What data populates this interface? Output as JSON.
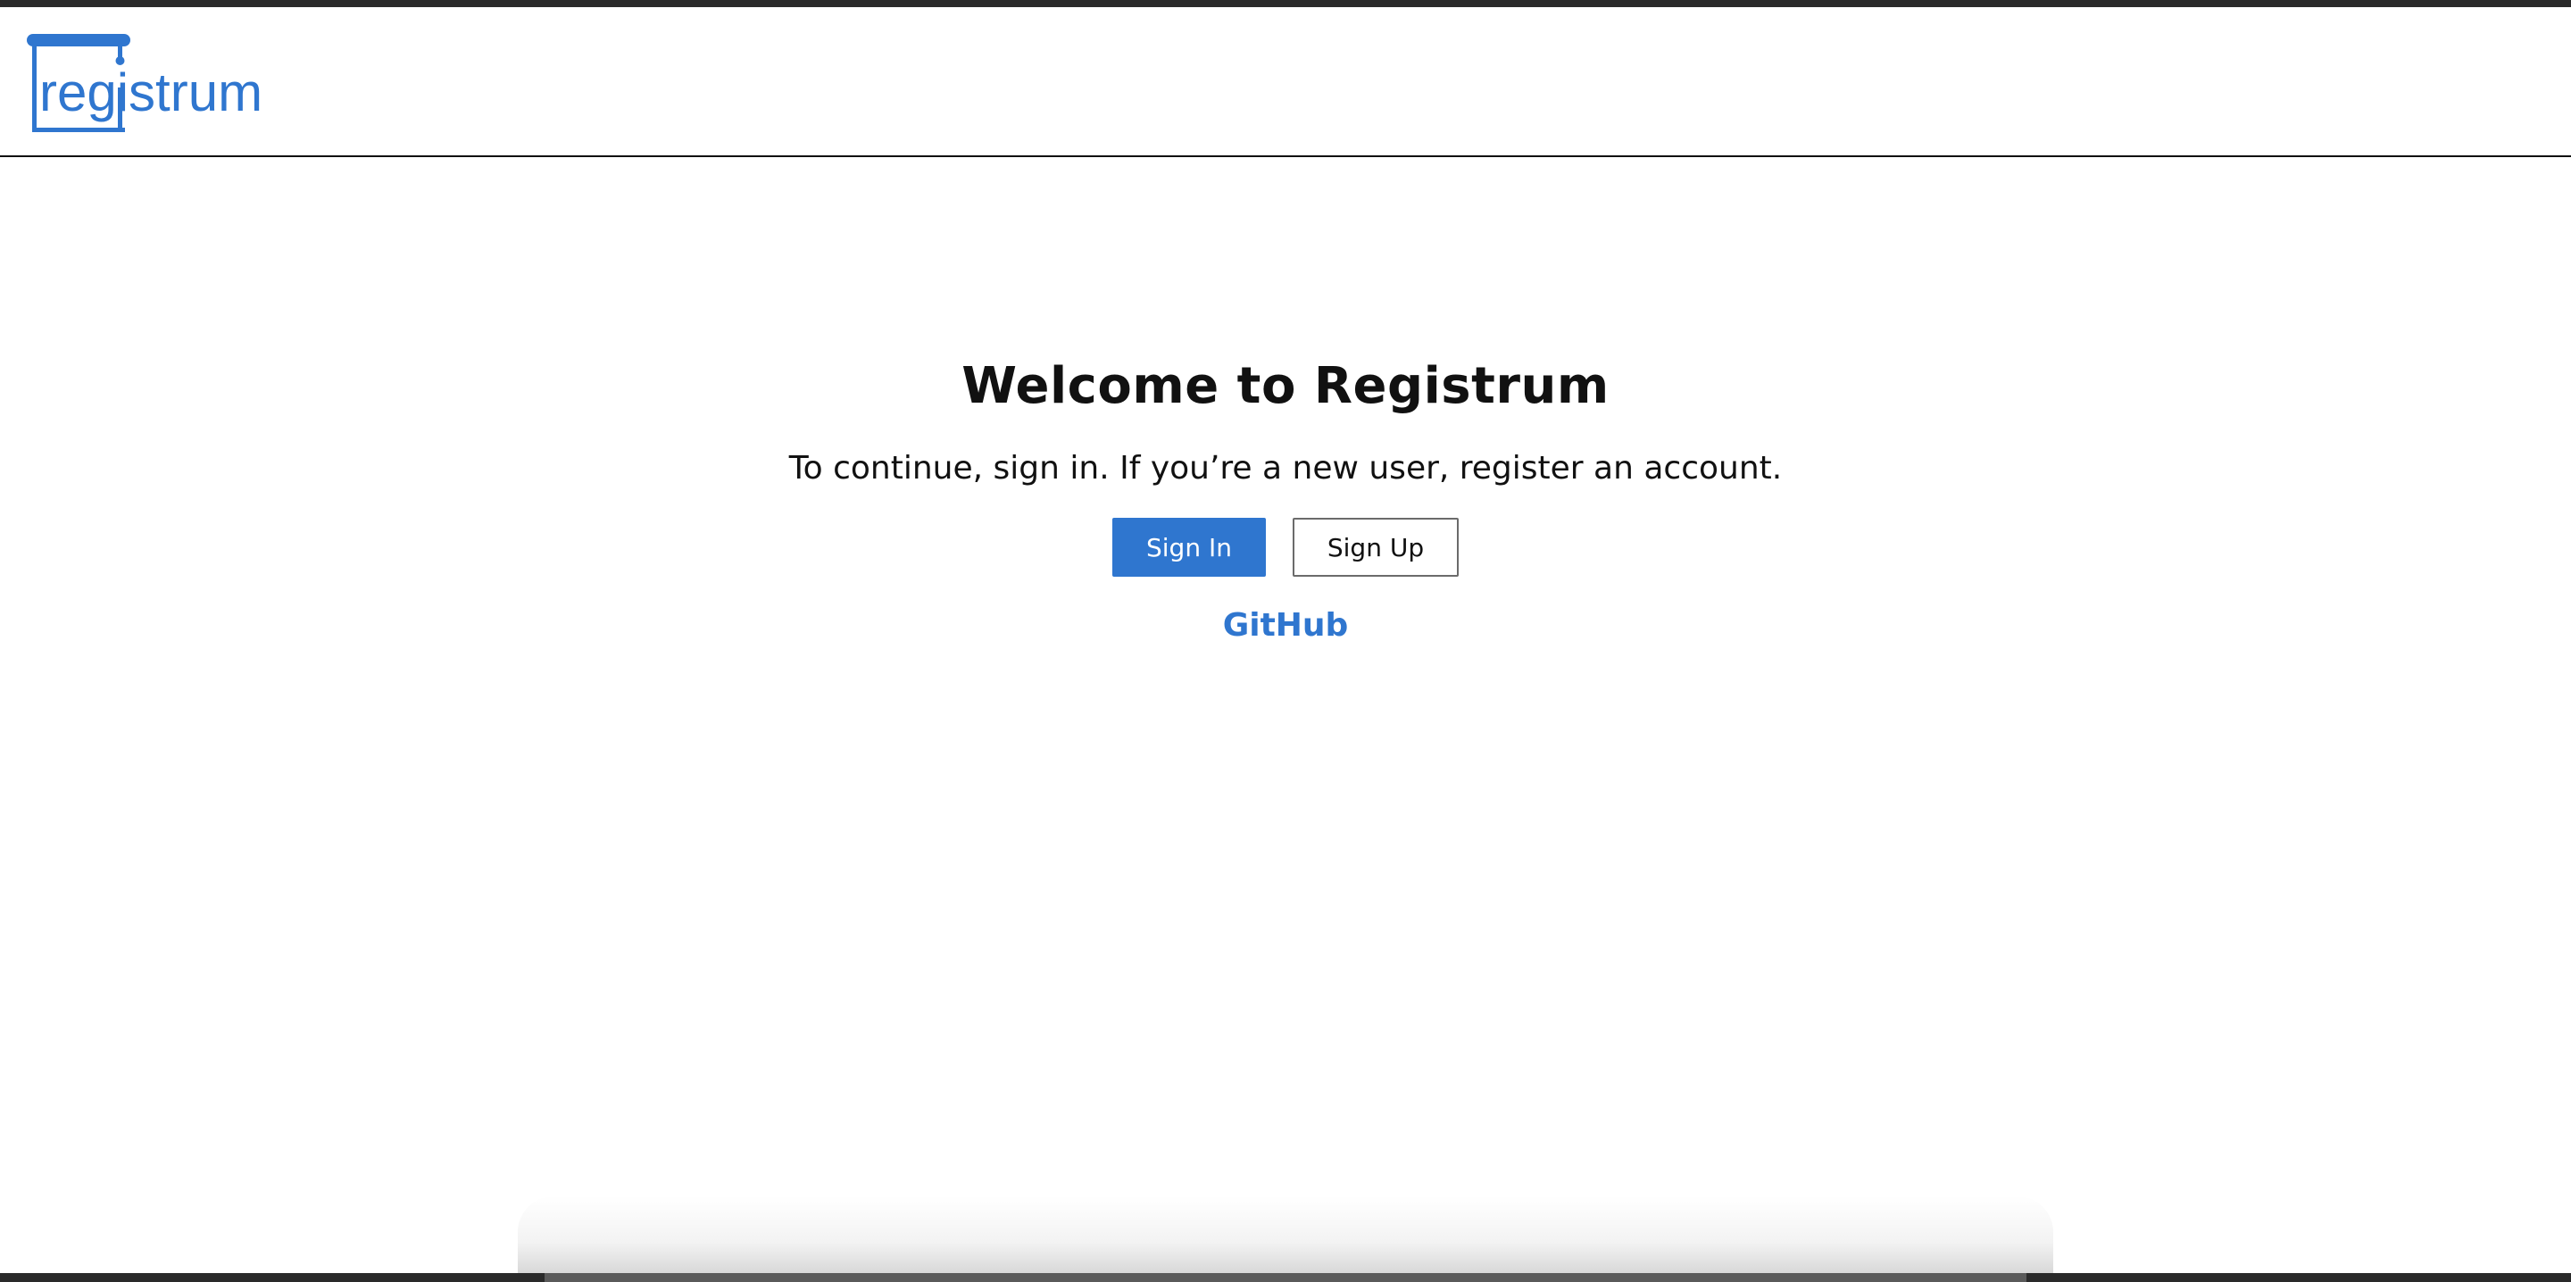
{
  "header": {
    "logo_text": "registrum",
    "brand_color": "#2f76cf"
  },
  "main": {
    "title": "Welcome to Registrum",
    "subtitle": "To continue, sign in. If you’re a new user, register an account.",
    "sign_in_label": "Sign In",
    "sign_up_label": "Sign Up",
    "github_link": "GitHub"
  },
  "colors": {
    "accent": "#2f76cf",
    "text": "#111111",
    "frame": "#2a2a2a"
  }
}
